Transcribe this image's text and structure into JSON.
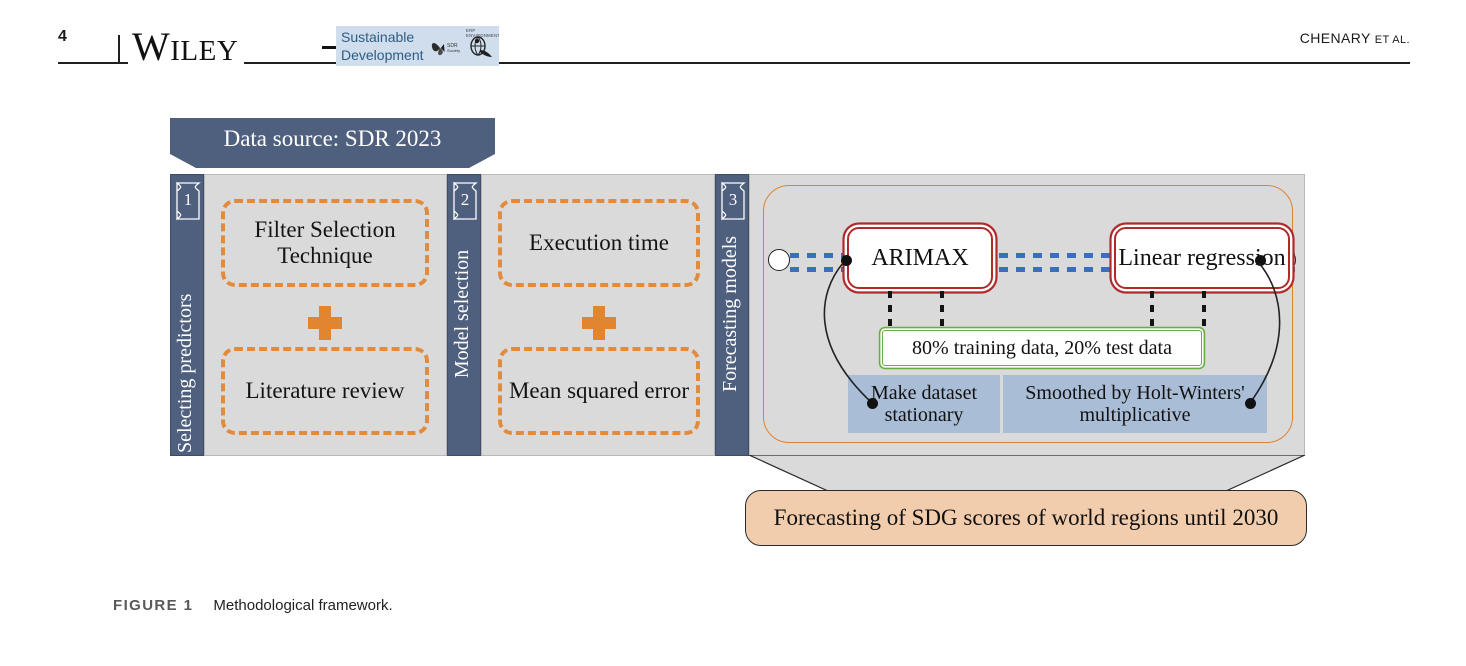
{
  "header": {
    "page_number": "4",
    "publisher": "WILEY",
    "journal_line1": "Sustainable",
    "journal_line2": "Development",
    "society_mark": "SDR Society",
    "erp_mark": "ERP ENVIRONMENT",
    "authors": "CHENARY",
    "authors_suffix": "ET AL."
  },
  "figure": {
    "banner": "Data source: SDR 2023",
    "stages": [
      {
        "number": "1",
        "label": "Selecting predictors"
      },
      {
        "number": "2",
        "label": "Model selection"
      },
      {
        "number": "3",
        "label": "Forecasting models"
      }
    ],
    "stage1_items": [
      "Filter Selection Technique",
      "Literature review"
    ],
    "stage2_items": [
      "Execution time",
      "Mean squared error"
    ],
    "operator": "+",
    "models": [
      "ARIMAX",
      "Linear regression"
    ],
    "split_note": "80% training data, 20% test data",
    "preprocessing": [
      "Make dataset stationary",
      "Smoothed by Holt-Winters' multiplicative"
    ],
    "outcome": "Forecasting of SDG scores of world regions until 2030"
  },
  "caption": {
    "label": "FIGURE 1",
    "text": "Methodological framework."
  },
  "colors": {
    "stage_rail": "#4f5f7e",
    "panel": "#dadada",
    "dashed_orange": "#e28b3c",
    "model_border": "#b02a2a",
    "split_border": "#6aab46",
    "preproc_fill": "#aabdd6",
    "outcome_fill": "#f2cdad",
    "flow_blue": "#3a6fbf"
  }
}
